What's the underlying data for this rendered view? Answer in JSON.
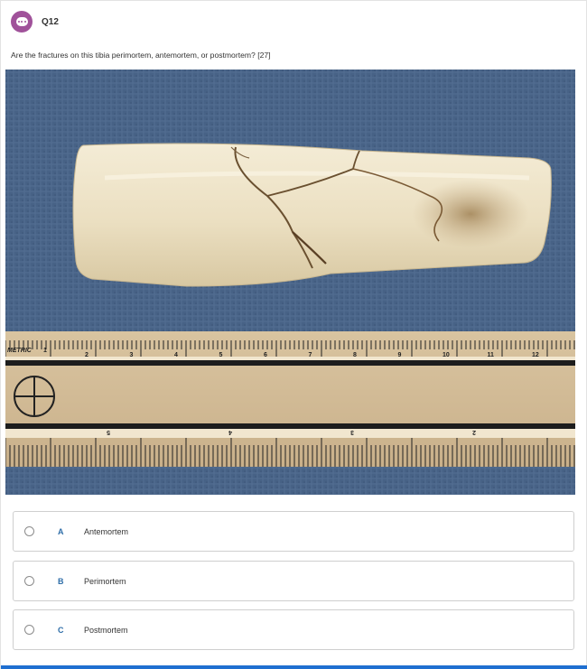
{
  "question": {
    "number": "Q12",
    "text": "Are the fractures on this tibia perimortem, antemortem, or postmortem? [27]",
    "badge_color": "#a0529a",
    "badge_icon": "chat-bubble-icon"
  },
  "image": {
    "alt": "Tibia fragment with fractures next to a metric ruler",
    "ruler": {
      "brand": "METRIC",
      "top_numbers": [
        "1",
        "2",
        "3",
        "4",
        "5",
        "6",
        "7",
        "8",
        "9",
        "10",
        "11",
        "12",
        "13"
      ],
      "bottom_numbers": [
        "2",
        "3",
        "4",
        "5",
        "6"
      ]
    }
  },
  "options": [
    {
      "letter": "A",
      "label": "Antemortem"
    },
    {
      "letter": "B",
      "label": "Perimortem"
    },
    {
      "letter": "C",
      "label": "Postmortem"
    }
  ],
  "colors": {
    "accent": "#1f6fd0",
    "option_letter": "#2f6ea8"
  }
}
